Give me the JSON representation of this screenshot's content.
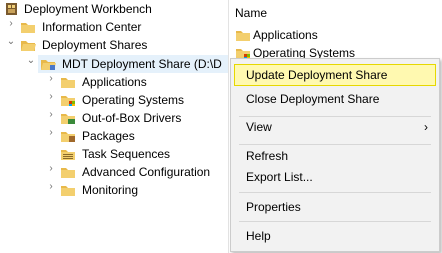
{
  "tree": {
    "root": "Deployment Workbench",
    "info_center": "Information Center",
    "deployment_shares": "Deployment Shares",
    "mdt_share": "MDT Deployment Share (D:\\D",
    "children": [
      "Applications",
      "Operating Systems",
      "Out-of-Box Drivers",
      "Packages",
      "Task Sequences",
      "Advanced Configuration",
      "Monitoring"
    ]
  },
  "list": {
    "header": "Name",
    "items": [
      "Applications",
      "Operating Systems"
    ]
  },
  "context_menu": {
    "items": [
      "Update Deployment Share",
      "Close Deployment Share",
      "View",
      "Refresh",
      "Export List...",
      "Properties",
      "Help"
    ]
  },
  "colors": {
    "highlight": "#fff9b0",
    "highlight_border": "#e6d800",
    "selection": "#e5f1fb",
    "folder": "#e8b94a"
  }
}
